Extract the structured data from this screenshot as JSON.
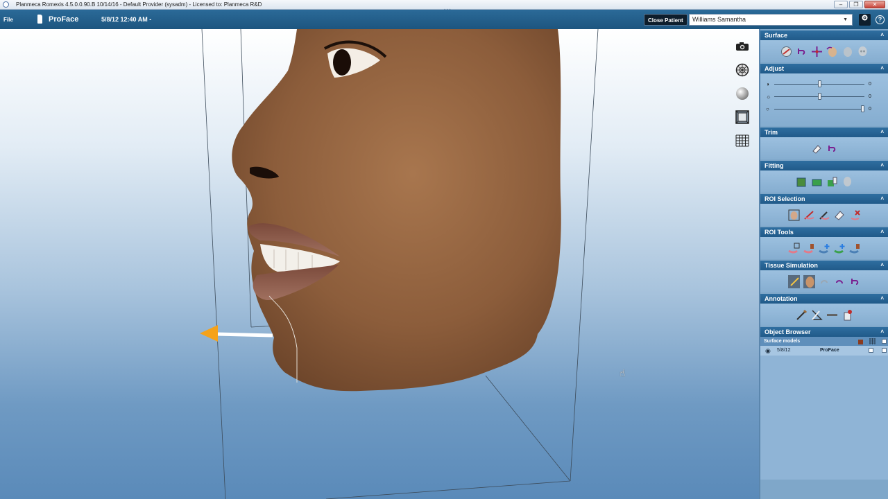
{
  "window": {
    "title": "Planmeca Romexis 4.5.0.0.90.B  10/14/16 - Default Provider (sysadm) - Licensed to: Planmeca R&D",
    "minimize": "–",
    "restore": "❐",
    "close": "✕"
  },
  "toolbar": {
    "file_menu": "File",
    "module_name": "ProFace",
    "study_date": "5/8/12 12:40 AM -",
    "close_patient": "Close Patient",
    "patient_name": "Williams Samantha",
    "help": "?"
  },
  "viewport": {
    "side_tools": [
      {
        "icon": "camera-icon",
        "label": "snapshot"
      },
      {
        "icon": "wireframe-sphere-icon",
        "label": "wireframe"
      },
      {
        "icon": "shaded-sphere-icon",
        "label": "shaded"
      },
      {
        "icon": "bounding-box-icon",
        "label": "bounding box"
      },
      {
        "icon": "grid-icon",
        "label": "grid"
      }
    ]
  },
  "panel": {
    "sections": {
      "surface": "Surface",
      "adjust": "Adjust",
      "trim": "Trim",
      "fitting": "Fitting",
      "roi_selection": "ROI Selection",
      "roi_tools": "ROI Tools",
      "tissue_simulation": "Tissue Simulation",
      "annotation": "Annotation",
      "object_browser": "Object Browser"
    },
    "adjust": {
      "sliders": [
        {
          "icon": "contrast-icon",
          "value": "0",
          "level": 0.5
        },
        {
          "icon": "brightness-icon",
          "value": "0",
          "level": 0.5
        },
        {
          "icon": "opacity-icon",
          "value": "0",
          "level": 1.0
        }
      ]
    },
    "object_browser": {
      "header": "Surface models",
      "rows": [
        {
          "date": "5/8/12",
          "model": "ProFace"
        }
      ]
    }
  },
  "colors": {
    "toolbar_bg": "#215e8c",
    "section_header": "#215a89",
    "panel_bg": "#7fa7c9",
    "arrow": "#f5a21b"
  }
}
